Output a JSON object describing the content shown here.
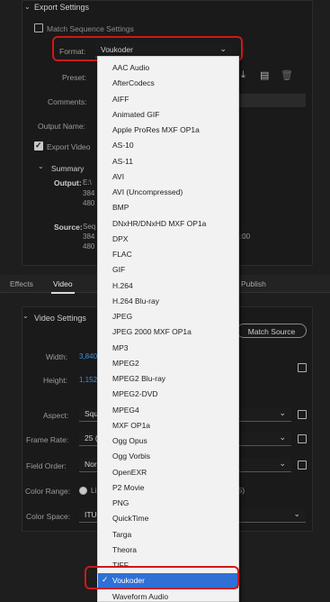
{
  "export_settings": {
    "title": "Export Settings",
    "match_sequence_label": "Match Sequence Settings",
    "format_label": "Format:",
    "format_value": "Voukoder",
    "preset_label": "Preset:",
    "comments_label": "Comments:",
    "output_name_label": "Output Name:",
    "export_video_label": "Export Video",
    "summary_label": "Summary",
    "output_label": "Output:",
    "output_line1": "E:\\",
    "output_line2": "384",
    "output_line3": "480",
    "source_label": "Source:",
    "source_line1": "Seq",
    "source_line2": "384",
    "source_line3": "480",
    "source_time_fragment": "31:00"
  },
  "tabs": {
    "effects": "Effects",
    "video": "Video",
    "publish": "Publish"
  },
  "video_settings": {
    "title": "Video Settings",
    "match_source_label": "Match Source",
    "width_label": "Width:",
    "width_value": "3,840",
    "height_label": "Height:",
    "height_value": "1,152",
    "aspect_label": "Aspect:",
    "aspect_value": "Squ",
    "frame_rate_label": "Frame Rate:",
    "frame_rate_value": "25 (",
    "field_order_label": "Field Order:",
    "field_order_value": "Nor",
    "color_range_label": "Color Range:",
    "color_range_value": "Li",
    "color_range_fragment": "255)",
    "color_space_label": "Color Space:",
    "color_space_value": "ITU"
  },
  "format_options": [
    "AAC Audio",
    "AfterCodecs",
    "AIFF",
    "Animated GIF",
    "Apple ProRes MXF OP1a",
    "AS-10",
    "AS-11",
    "AVI",
    "AVI (Uncompressed)",
    "BMP",
    "DNxHR/DNxHD MXF OP1a",
    "DPX",
    "FLAC",
    "GIF",
    "H.264",
    "H.264 Blu-ray",
    "JPEG",
    "JPEG 2000 MXF OP1a",
    "MP3",
    "MPEG2",
    "MPEG2 Blu-ray",
    "MPEG2-DVD",
    "MPEG4",
    "MXF OP1a",
    "Ogg Opus",
    "Ogg Vorbis",
    "OpenEXR",
    "P2 Movie",
    "PNG",
    "QuickTime",
    "Targa",
    "Theora",
    "TIFF",
    "Voukoder",
    "Waveform Audio"
  ],
  "selected_format_index": 33,
  "colors": {
    "annotation": "#d01818",
    "selection": "#2f70d6",
    "link_blue": "#3d8fe0"
  }
}
